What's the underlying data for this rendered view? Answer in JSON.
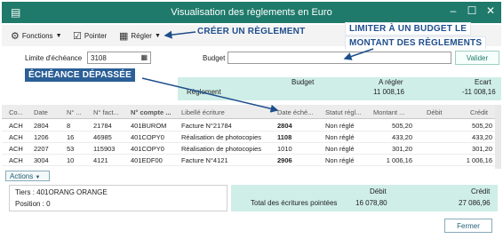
{
  "window": {
    "title": "Visualisation des règlements en Euro",
    "controls": {
      "minimize": "–",
      "maximize": "☐",
      "close": "✕"
    }
  },
  "toolbar": {
    "fonctions_label": "Fonctions",
    "pointer_label": "Pointer",
    "regler_label": "Régler"
  },
  "annotations": {
    "creer": "CRÉER UN RÈGLEMENT",
    "limiter_line1": "LIMITER À UN BUDGET LE",
    "limiter_line2": "MONTANT DES RÈGLEMENTS",
    "echeance": "ÉCHÉANCE DÉPASSÉE"
  },
  "filters": {
    "limite_label": "Limite d'échéance",
    "limite_value": "3108",
    "budget_label": "Budget",
    "budget_value": "",
    "valider_label": "Valider"
  },
  "summary": {
    "budget_header": "Budget",
    "a_regler_header": "A régler",
    "ecart_header": "Ecart",
    "row_label": "Règlement",
    "a_regler_value": "11 008,16",
    "ecart_value": "-11 008,16"
  },
  "table": {
    "headers": [
      "Co...",
      "Date",
      "N° ...",
      "N° fact...",
      "N° compte ...",
      "Libellé écriture",
      "Date éché...",
      "Statut régl...",
      "Montant ...",
      "Débit",
      "Crédit"
    ],
    "rows": [
      [
        "ACH",
        "2804",
        "8",
        "21784",
        "401BUROM",
        "Facture N°21784",
        "2804",
        "Non réglé",
        "505,20",
        "",
        "505,20"
      ],
      [
        "ACH",
        "1206",
        "16",
        "46985",
        "401COPY0",
        "Réalisation de photocopies",
        "1108",
        "Non réglé",
        "433,20",
        "",
        "433,20"
      ],
      [
        "ACH",
        "2207",
        "53",
        "115903",
        "401COPY0",
        "Réalisation de photocopies",
        "1010",
        "Non réglé",
        "301,20",
        "",
        "301,20"
      ],
      [
        "ACH",
        "3004",
        "10",
        "4121",
        "401EDF00",
        "Facture N°4121",
        "2906",
        "Non réglé",
        "1 006,16",
        "",
        "1 006,16"
      ]
    ]
  },
  "actions_label": "Actions",
  "footer": {
    "tiers": "Tiers : 401ORANG ORANGE",
    "position": "Position : 0",
    "debit_header": "Débit",
    "credit_header": "Crédit",
    "total_label": "Total des écritures pointées",
    "debit_value": "16 078,80",
    "credit_value": "27 086,96"
  },
  "fermer_label": "Fermer",
  "colors": {
    "title_bar": "#1f7a6b",
    "summary_bg": "#cfeee7",
    "annotation": "#1f4e8c"
  }
}
